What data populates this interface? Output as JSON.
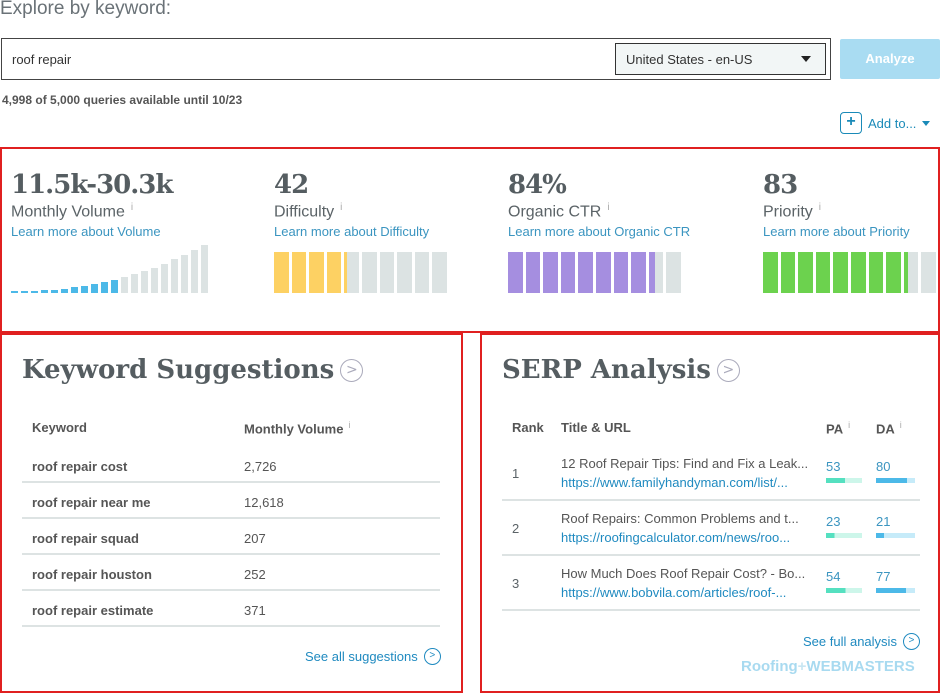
{
  "header": {
    "title": "Explore by keyword:",
    "query": "roof repair",
    "locale": "United States - en-US",
    "analyze_label": "Analyze",
    "quota": "4,998 of 5,000 queries available until 10/23",
    "add_to_label": "Add to..."
  },
  "metrics": [
    {
      "value": "11.5k-30.3k",
      "label": "Monthly Volume",
      "info": "i",
      "link": "Learn more about Volume"
    },
    {
      "value": "42",
      "label": "Difficulty",
      "info": "i",
      "link": "Learn more about Difficulty",
      "fill": 0.42,
      "color": "#fdd163"
    },
    {
      "value": "84%",
      "label": "Organic CTR",
      "info": "i",
      "link": "Learn more about Organic CTR",
      "fill": 0.84,
      "color": "#a58ee0"
    },
    {
      "value": "83",
      "label": "Priority",
      "info": "i",
      "link": "Learn more about Priority",
      "fill": 0.83,
      "color": "#6cd24e"
    }
  ],
  "volume_bars": {
    "total": 20,
    "highlighted": 11,
    "color": "#4cb9e8"
  },
  "suggestions": {
    "title": "Keyword Suggestions",
    "col_keyword": "Keyword",
    "col_volume": "Monthly Volume",
    "info": "i",
    "rows": [
      {
        "keyword": "roof repair cost",
        "volume": "2,726"
      },
      {
        "keyword": "roof repair near me",
        "volume": "12,618"
      },
      {
        "keyword": "roof repair squad",
        "volume": "207"
      },
      {
        "keyword": "roof repair houston",
        "volume": "252"
      },
      {
        "keyword": "roof repair estimate",
        "volume": "371"
      }
    ],
    "see_all": "See all suggestions"
  },
  "serp": {
    "title": "SERP Analysis",
    "col_rank": "Rank",
    "col_title": "Title & URL",
    "col_pa": "PA",
    "col_da": "DA",
    "info": "i",
    "rows": [
      {
        "rank": "1",
        "title": "12 Roof Repair Tips: Find and Fix a Leak...",
        "url": "https://www.familyhandyman.com/list/...",
        "pa": "53",
        "da": "80"
      },
      {
        "rank": "2",
        "title": "Roof Repairs: Common Problems and t...",
        "url": "https://roofingcalculator.com/news/roo...",
        "pa": "23",
        "da": "21"
      },
      {
        "rank": "3",
        "title": "How Much Does Roof Repair Cost? - Bo...",
        "url": "https://www.bobvila.com/articles/roof-...",
        "pa": "54",
        "da": "77"
      }
    ],
    "see_full": "See full analysis"
  },
  "watermark": "Roofing+WEBMASTERS"
}
